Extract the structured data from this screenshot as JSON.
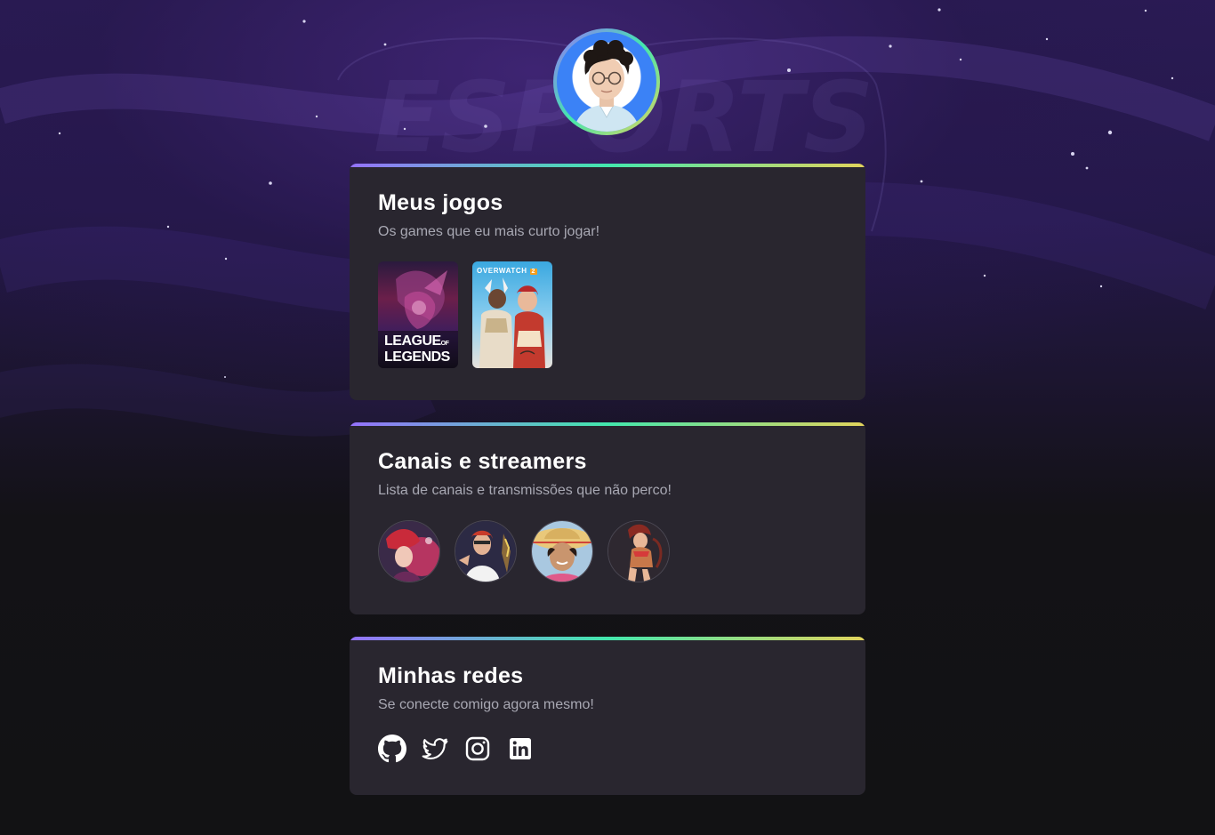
{
  "profile": {
    "avatar_icon": "profile-photo",
    "ring_colors": [
      "#9572FC",
      "#43E7AD",
      "#E2D45C"
    ]
  },
  "sections": {
    "games": {
      "title": "Meus jogos",
      "subtitle": "Os games que eu mais curto jogar!",
      "items": [
        {
          "label_line1": "LEAGUE",
          "label_of": "OF",
          "label_line2": "LEGENDS"
        },
        {
          "label": "OVERWATCH",
          "badge": "2"
        }
      ]
    },
    "streamers": {
      "title": "Canais e streamers",
      "subtitle": "Lista de canais e transmissões que não perco!",
      "items": [
        {
          "icon": "streamer-avatar-1"
        },
        {
          "icon": "streamer-avatar-2"
        },
        {
          "icon": "streamer-avatar-3"
        },
        {
          "icon": "streamer-avatar-4"
        }
      ]
    },
    "socials": {
      "title": "Minhas redes",
      "subtitle": "Se conecte comigo agora mesmo!",
      "items": [
        {
          "icon": "github-icon"
        },
        {
          "icon": "twitter-icon"
        },
        {
          "icon": "instagram-icon"
        },
        {
          "icon": "linkedin-icon"
        }
      ]
    }
  },
  "colors": {
    "background": "#121214",
    "card": "#29262F",
    "text_title": "#FFFFFF",
    "text_subtitle": "#A8A8B3"
  }
}
